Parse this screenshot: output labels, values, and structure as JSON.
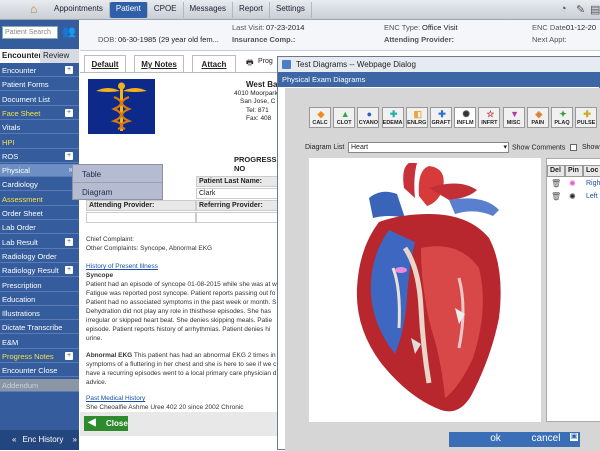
{
  "topbar": {
    "search_label": "Patient Search",
    "menus": [
      "Appointments",
      "Patient",
      "CPOE",
      "Messages",
      "Report",
      "Settings"
    ]
  },
  "header": {
    "dob_label": "DOB:",
    "dob_value": "06-30-1985 (29 year old fem...",
    "last_visit_label": "Last Visit:",
    "last_visit_value": "07-23-2014",
    "insurance_label": "Insurance Comp.:",
    "enc_type_label": "ENC Type:",
    "enc_type_value": "Office Visit",
    "attending_label": "Attending Provider:",
    "enc_date_label": "ENC Date:",
    "enc_date_value": "01-12-20",
    "next_appt_label": "Next Appt:"
  },
  "sidebar": {
    "tab_encounter": "Encounter",
    "tab_review": "Review",
    "items": [
      "Encounter",
      "Patient Forms",
      "Document List",
      "Face Sheet",
      "Vitals",
      "HPI",
      "ROS",
      "Physical",
      "Cardiology",
      "Assessment",
      "Order Sheet",
      "Lab Order",
      "Lab Result",
      "Radiology Order",
      "Radiology Result",
      "Prescription",
      "Education",
      "Illustrations",
      "Dictate Transcribe",
      "E&M",
      "Progress Notes",
      "Encounter Close",
      "Addendum"
    ],
    "enc_history": "Enc History"
  },
  "submenu": {
    "table": "Table",
    "diagram": "Diagram"
  },
  "content": {
    "tabs": [
      "Default",
      "My Notes",
      "Attach"
    ],
    "prog_label": "Prog",
    "clinic_name": "West Bay",
    "clinic_addr1": "4010 Moorpark",
    "clinic_addr2": "San Jose, C",
    "clinic_tel": "Tel: 871",
    "clinic_fax": "Fax: 408",
    "progress_title": "PROGRESS NO",
    "patient_last_name_label": "Patient Last Name:",
    "patient_last_name": "Clark",
    "attending_label": "Attending Provider:",
    "referring_label": "Referring Provider:",
    "chief_complaint": "Chief Complaint:",
    "other_complaints": "Other Complaints: Syncope, Abnormal EKG",
    "hpi_link": "History of Present Illness",
    "syncope_label": "Syncope",
    "syncope_text": [
      "Patient had an episode of syncope 01-08-2015 while she was at w",
      "Fatigue was reported post syncope. Patient reports passing out fo",
      "Patient had no associated symptoms in the past week or month. S",
      "Dehydration did not play any role in thisthese episodes. She has",
      "irregular or skipped heart beat. She denies skipping meals. Patie",
      "episode. Patient reports history of arrhythmias. Patient denies hi",
      "urine."
    ],
    "ekg_label": "Abnormal EKG",
    "ekg_text": [
      " This patient has had an abnormal EKG 2 times in",
      "symptoms of a fluttering in her chest and she is here to see if we c",
      "have a recurring episodes went to a local primary care physician d",
      "advice."
    ],
    "pmh_link": "Past Medical History",
    "pmh_text": "She Cheoalfie Ashme Uree 402 20 since 2002 Chronic",
    "close_btn": "Close"
  },
  "dialog": {
    "title": "Test Diagrams -- Webpage Dialog",
    "subtitle": "Physical Exam Diagrams",
    "icons": [
      "CALC",
      "CLOT",
      "CYANO",
      "EDEMA",
      "ENLRG",
      "GRAFT",
      "INFLM",
      "INFRT",
      "MISC",
      "PAIN",
      "PLAQ",
      "PULSE"
    ],
    "diagram_list_label": "Diagram List",
    "diagram_list_value": "Heart",
    "show_comments": "Show Comments",
    "show_label": "Show",
    "table_headers": [
      "Del",
      "Pin",
      "Loc"
    ],
    "table_rows": [
      {
        "loc": "Righ"
      },
      {
        "loc": "Left"
      }
    ],
    "ok": "ok",
    "cancel": "cancel"
  },
  "colors": {
    "accent": "#355c9c",
    "title_blue": "#3d66a5",
    "highlight": "#f4e04a"
  }
}
